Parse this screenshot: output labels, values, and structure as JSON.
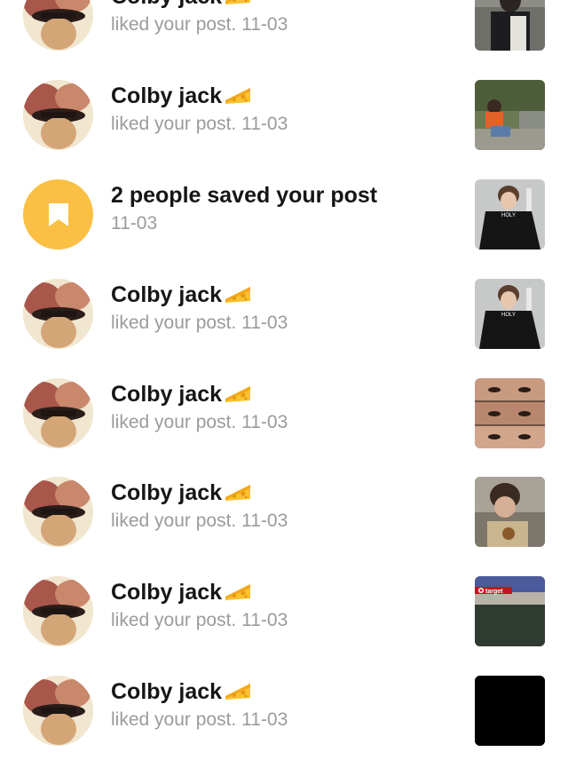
{
  "notifications": [
    {
      "kind": "like",
      "name": "Colby jack",
      "emoji_icon": "cheese-icon",
      "action": "liked your post.",
      "time": "11-03",
      "thumbnail": "post-thumbnail-girl-dark-jacket"
    },
    {
      "kind": "like",
      "name": "Colby jack",
      "emoji_icon": "cheese-icon",
      "action": "liked your post.",
      "time": "11-03",
      "thumbnail": "post-thumbnail-person-sitting-outdoors"
    },
    {
      "kind": "saved",
      "title": "2 people saved your post",
      "time": "11-03",
      "icon": "bookmark-icon",
      "icon_bg": "#fbc043",
      "thumbnail": "post-thumbnail-boy-holy-shirt"
    },
    {
      "kind": "like",
      "name": "Colby jack",
      "emoji_icon": "cheese-icon",
      "action": "liked your post.",
      "time": "11-03",
      "thumbnail": "post-thumbnail-boy-holy-shirt"
    },
    {
      "kind": "like",
      "name": "Colby jack",
      "emoji_icon": "cheese-icon",
      "action": "liked your post.",
      "time": "11-03",
      "thumbnail": "post-thumbnail-eyes-collage"
    },
    {
      "kind": "like",
      "name": "Colby jack",
      "emoji_icon": "cheese-icon",
      "action": "liked your post.",
      "time": "11-03",
      "thumbnail": "post-thumbnail-selfie-street"
    },
    {
      "kind": "like",
      "name": "Colby jack",
      "emoji_icon": "cheese-icon",
      "action": "liked your post.",
      "time": "11-03",
      "thumbnail": "post-thumbnail-target-parking-lot"
    },
    {
      "kind": "like",
      "name": "Colby jack",
      "emoji_icon": "cheese-icon",
      "action": "liked your post.",
      "time": "11-03",
      "thumbnail": "post-thumbnail-black"
    }
  ],
  "thumbnail_text": {
    "holy": "HOLY",
    "target": "target"
  },
  "colors": {
    "name_text": "#161616",
    "secondary_text": "#9b9b9b",
    "saved_icon_bg": "#fbc043",
    "background": "#ffffff"
  }
}
